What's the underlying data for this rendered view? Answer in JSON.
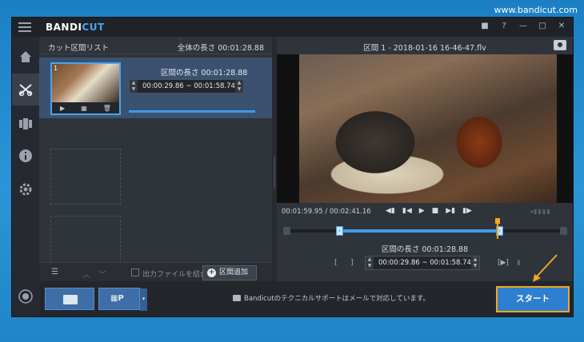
{
  "site": {
    "url": "www.bandicut.com"
  },
  "app": {
    "logo_part1": "BANDI",
    "logo_part2": "CUT"
  },
  "window_controls": [
    "folder-icon",
    "help-icon",
    "minimize-icon",
    "maximize-icon",
    "close-icon"
  ],
  "window_control_glyphs": [
    "■",
    "?",
    "—",
    "□",
    "✕"
  ],
  "sidebar": {
    "items": [
      {
        "name": "home-icon"
      },
      {
        "name": "cut-icon",
        "active": true
      },
      {
        "name": "join-icon"
      },
      {
        "name": "info-icon"
      },
      {
        "name": "settings-icon"
      },
      {
        "name": "record-icon"
      }
    ]
  },
  "left_panel": {
    "title": "カット区間リスト",
    "total_length": "全体の長さ 00:01:28.88",
    "segment": {
      "number": "1",
      "length_label": "区間の長さ 00:01:28.88",
      "range": "00:00:29.86  ~  00:01:58.74"
    },
    "merge_label": "出力ファイルを結合",
    "add_button": "区間追加"
  },
  "right_panel": {
    "title": "区間 1 - 2018-01-16 16-46-47.flv",
    "time_display": "00:01:59.95 / 00:02:41.16",
    "segment_length": "区間の長さ 00:01:28.88",
    "range": "00:00:29.86  ~  00:01:58.74",
    "bracket_start": "[",
    "bracket_end": "]",
    "bracket_play": "[▶]"
  },
  "bottom": {
    "convert_label": "P",
    "support_text": "Bandicutのテクニカルサポートはメールで対応しています。",
    "start_button": "スタート"
  },
  "colors": {
    "accent": "#3f9ce8",
    "highlight": "#f5a623"
  }
}
